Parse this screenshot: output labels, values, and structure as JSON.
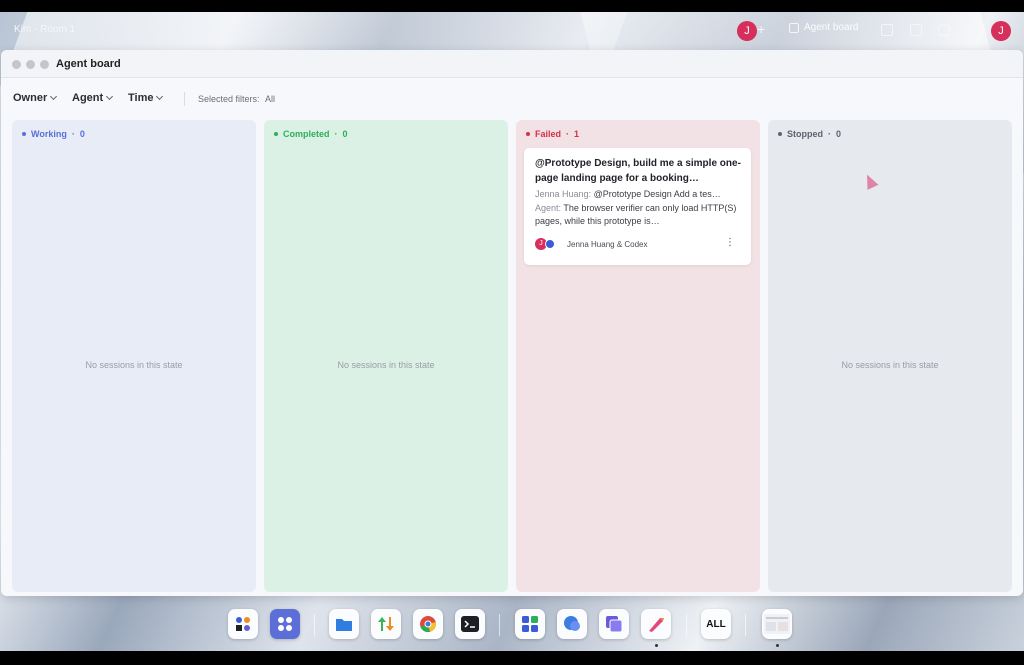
{
  "topbar": {
    "room_title": "Kim - Room 1",
    "avatar_initial": "J",
    "add_label": "+",
    "agent_board_label": "Agent board",
    "profile_initial": "J"
  },
  "window": {
    "title": "Agent board"
  },
  "filters": {
    "owner": "Owner",
    "agent": "Agent",
    "time": "Time",
    "selected_label": "Selected filters:",
    "selected_value": "All"
  },
  "columns": [
    {
      "label": "Working",
      "count": "0",
      "color": "#5b6fd6",
      "bg": "#e8ecf7",
      "empty": "No sessions in this state"
    },
    {
      "label": "Completed",
      "count": "0",
      "color": "#2fae5a",
      "bg": "#dcf1e6",
      "empty": "No sessions in this state"
    },
    {
      "label": "Failed",
      "count": "1",
      "color": "#d0334a",
      "bg": "#f3e2e5",
      "empty": ""
    },
    {
      "label": "Stopped",
      "count": "0",
      "color": "#5f6270",
      "bg": "#e6e9ee",
      "empty": "No sessions in this state"
    }
  ],
  "card": {
    "title": "@Prototype Design, build me a simple one-page landing page for a booking…",
    "user_name": "Jenna Huang:",
    "user_msg": "@Prototype Design Add a tes…",
    "agent_name": "Agent:",
    "agent_msg": "The browser verifier can only load HTTP(S) pages, while this prototype is…",
    "avatar_initial": "J",
    "participants": "Jenna Huang & Codex",
    "menu": "⋮"
  },
  "dock": {
    "all_label": "ALL",
    "icons": [
      "widgets-icon",
      "apps-grid-icon",
      "folder-icon",
      "transfer-icon",
      "chrome-icon",
      "terminal-icon",
      "windows-icon",
      "chat-icon",
      "copy-icon",
      "design-icon",
      "all-icon",
      "preview-thumbnail"
    ]
  }
}
